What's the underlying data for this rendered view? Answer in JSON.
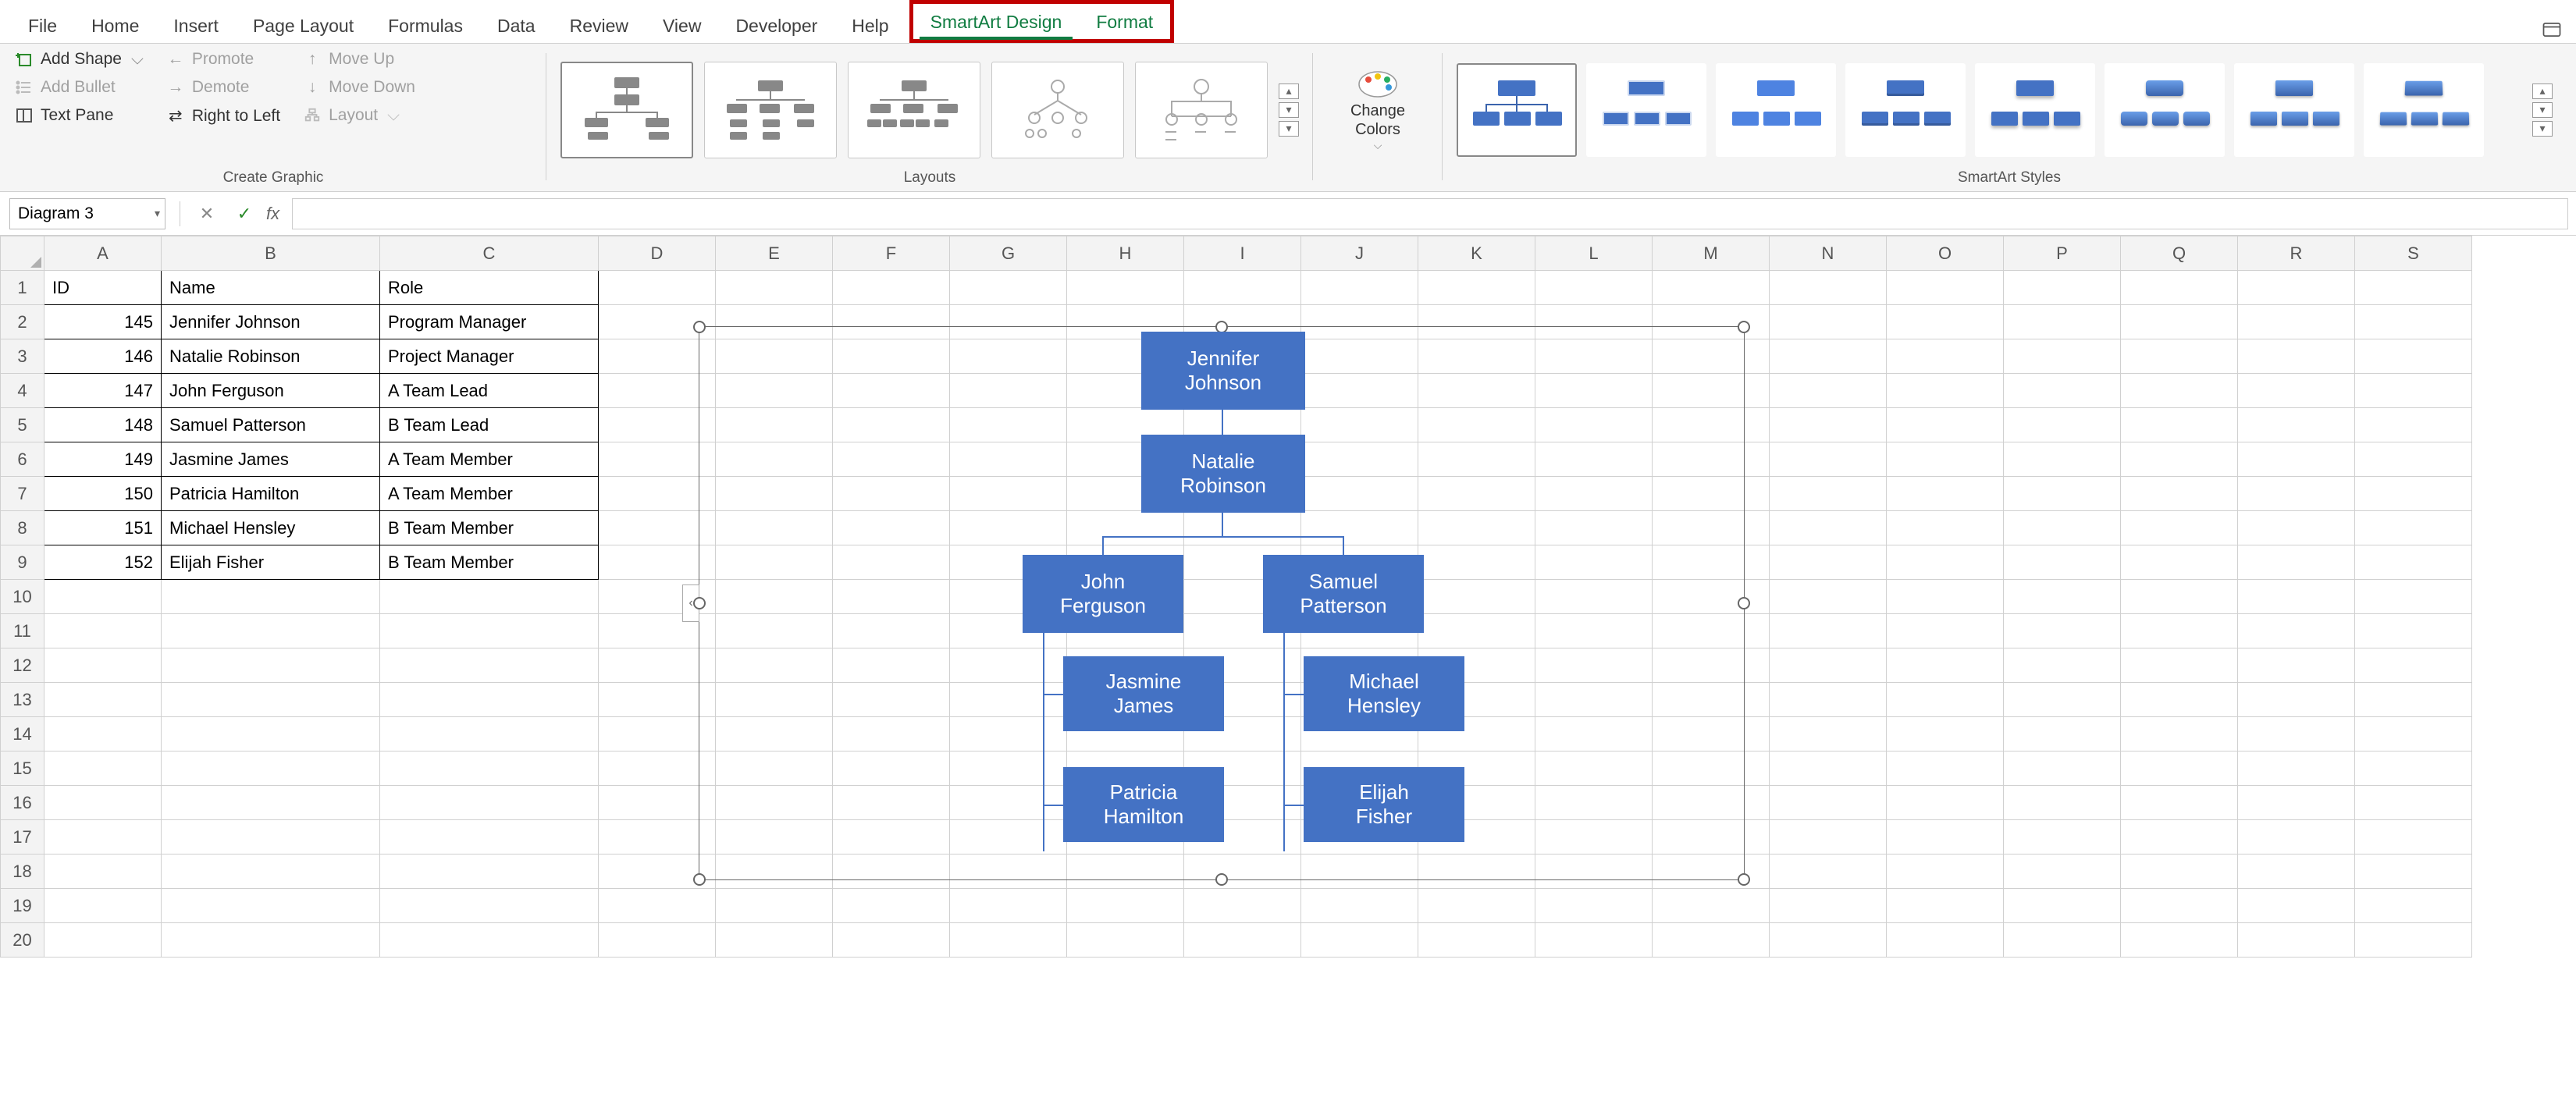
{
  "tabs": {
    "file": "File",
    "home": "Home",
    "insert": "Insert",
    "pl": "Page Layout",
    "formulas": "Formulas",
    "data": "Data",
    "review": "Review",
    "view": "View",
    "developer": "Developer",
    "help": "Help",
    "sa_design": "SmartArt Design",
    "format": "Format"
  },
  "ribbon": {
    "create": {
      "add_shape": "Add Shape",
      "add_bullet": "Add Bullet",
      "text_pane": "Text Pane",
      "promote": "Promote",
      "demote": "Demote",
      "rtl": "Right to Left",
      "move_up": "Move Up",
      "move_down": "Move Down",
      "layout_menu": "Layout",
      "label": "Create Graphic"
    },
    "layouts_label": "Layouts",
    "change_colors": "Change\nColors",
    "styles_label": "SmartArt Styles"
  },
  "namebox": "Diagram 3",
  "fx": "fx",
  "cols": {
    "A": "A",
    "B": "B",
    "C": "C",
    "D": "D",
    "E": "E",
    "F": "F",
    "G": "G",
    "H": "H",
    "I": "I",
    "J": "J",
    "K": "K",
    "L": "L",
    "M": "M",
    "N": "N",
    "O": "O",
    "P": "P",
    "Q": "Q",
    "R": "R",
    "S": "S"
  },
  "headers": {
    "id": "ID",
    "name": "Name",
    "role": "Role"
  },
  "rows": [
    {
      "id": "145",
      "name": "Jennifer Johnson",
      "role": "Program Manager"
    },
    {
      "id": "146",
      "name": "Natalie Robinson",
      "role": "Project Manager"
    },
    {
      "id": "147",
      "name": "John Ferguson",
      "role": "A Team Lead"
    },
    {
      "id": "148",
      "name": "Samuel Patterson",
      "role": "B Team Lead"
    },
    {
      "id": "149",
      "name": "Jasmine James",
      "role": "A Team Member"
    },
    {
      "id": "150",
      "name": "Patricia Hamilton",
      "role": "A Team Member"
    },
    {
      "id": "151",
      "name": "Michael Hensley",
      "role": "B Team Member"
    },
    {
      "id": "152",
      "name": "Elijah Fisher",
      "role": "B Team Member"
    }
  ],
  "org": {
    "n0": "Jennifer\nJohnson",
    "n1": "Natalie\nRobinson",
    "n2": "John\nFerguson",
    "n3": "Samuel\nPatterson",
    "n4": "Jasmine\nJames",
    "n5": "Patricia\nHamilton",
    "n6": "Michael\nHensley",
    "n7": "Elijah\nFisher"
  }
}
